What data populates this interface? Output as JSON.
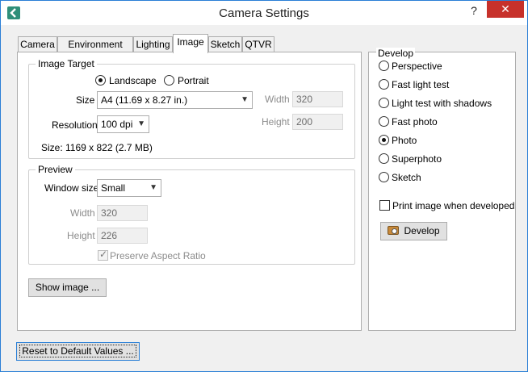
{
  "window": {
    "title": "Camera Settings",
    "help_label": "?",
    "close_label": "✕"
  },
  "tabs": [
    {
      "label": "Camera"
    },
    {
      "label": "Environment"
    },
    {
      "label": "Lighting"
    },
    {
      "label": "Image",
      "active": true
    },
    {
      "label": "Sketch"
    },
    {
      "label": "QTVR"
    }
  ],
  "image_target": {
    "title": "Image Target",
    "orientation": {
      "landscape_label": "Landscape",
      "portrait_label": "Portrait",
      "selected": "Landscape"
    },
    "size_label": "Size",
    "size_value": "A4 (11.69 x 8.27 in.)",
    "resolution_label": "Resolution",
    "resolution_value": "100 dpi",
    "width_label": "Width",
    "width_value": "320",
    "height_label": "Height",
    "height_value": "200",
    "size_info": "Size: 1169 x 822 (2.7 MB)"
  },
  "preview": {
    "title": "Preview",
    "window_size_label": "Window size",
    "window_size_value": "Small",
    "width_label": "Width",
    "width_value": "320",
    "height_label": "Height",
    "height_value": "226",
    "aspect_label": "Preserve Aspect Ratio",
    "aspect_checked": true
  },
  "show_image_label": "Show image ...",
  "reset_label": "Reset to Default Values ...",
  "develop": {
    "title": "Develop",
    "options": [
      {
        "label": "Perspective"
      },
      {
        "label": "Fast light test"
      },
      {
        "label": "Light test with shadows"
      },
      {
        "label": "Fast photo"
      },
      {
        "label": "Photo",
        "selected": true
      },
      {
        "label": "Superphoto"
      },
      {
        "label": "Sketch"
      }
    ],
    "print_label": "Print image when developed",
    "print_checked": false,
    "develop_button_label": "Develop"
  },
  "icons": {
    "app": "back-arrow-icon",
    "camera": "camera-icon",
    "dropdown": "chevron-down-icon"
  },
  "colors": {
    "accent": "#2a7fd6",
    "close": "#c7312b",
    "app_icon": "#2f8f7a"
  }
}
